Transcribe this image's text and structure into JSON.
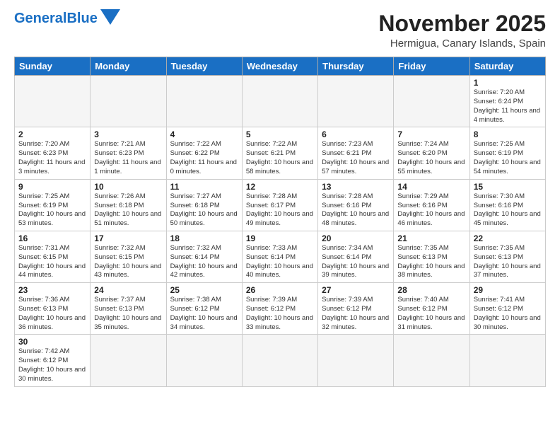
{
  "header": {
    "logo_general": "General",
    "logo_blue": "Blue",
    "month_title": "November 2025",
    "location": "Hermigua, Canary Islands, Spain"
  },
  "weekdays": [
    "Sunday",
    "Monday",
    "Tuesday",
    "Wednesday",
    "Thursday",
    "Friday",
    "Saturday"
  ],
  "weeks": [
    [
      {
        "day": "",
        "info": ""
      },
      {
        "day": "",
        "info": ""
      },
      {
        "day": "",
        "info": ""
      },
      {
        "day": "",
        "info": ""
      },
      {
        "day": "",
        "info": ""
      },
      {
        "day": "",
        "info": ""
      },
      {
        "day": "1",
        "info": "Sunrise: 7:20 AM\nSunset: 6:24 PM\nDaylight: 11 hours\nand 4 minutes."
      }
    ],
    [
      {
        "day": "2",
        "info": "Sunrise: 7:20 AM\nSunset: 6:23 PM\nDaylight: 11 hours\nand 3 minutes."
      },
      {
        "day": "3",
        "info": "Sunrise: 7:21 AM\nSunset: 6:23 PM\nDaylight: 11 hours\nand 1 minute."
      },
      {
        "day": "4",
        "info": "Sunrise: 7:22 AM\nSunset: 6:22 PM\nDaylight: 11 hours\nand 0 minutes."
      },
      {
        "day": "5",
        "info": "Sunrise: 7:22 AM\nSunset: 6:21 PM\nDaylight: 10 hours\nand 58 minutes."
      },
      {
        "day": "6",
        "info": "Sunrise: 7:23 AM\nSunset: 6:21 PM\nDaylight: 10 hours\nand 57 minutes."
      },
      {
        "day": "7",
        "info": "Sunrise: 7:24 AM\nSunset: 6:20 PM\nDaylight: 10 hours\nand 55 minutes."
      },
      {
        "day": "8",
        "info": "Sunrise: 7:25 AM\nSunset: 6:19 PM\nDaylight: 10 hours\nand 54 minutes."
      }
    ],
    [
      {
        "day": "9",
        "info": "Sunrise: 7:25 AM\nSunset: 6:19 PM\nDaylight: 10 hours\nand 53 minutes."
      },
      {
        "day": "10",
        "info": "Sunrise: 7:26 AM\nSunset: 6:18 PM\nDaylight: 10 hours\nand 51 minutes."
      },
      {
        "day": "11",
        "info": "Sunrise: 7:27 AM\nSunset: 6:18 PM\nDaylight: 10 hours\nand 50 minutes."
      },
      {
        "day": "12",
        "info": "Sunrise: 7:28 AM\nSunset: 6:17 PM\nDaylight: 10 hours\nand 49 minutes."
      },
      {
        "day": "13",
        "info": "Sunrise: 7:28 AM\nSunset: 6:16 PM\nDaylight: 10 hours\nand 48 minutes."
      },
      {
        "day": "14",
        "info": "Sunrise: 7:29 AM\nSunset: 6:16 PM\nDaylight: 10 hours\nand 46 minutes."
      },
      {
        "day": "15",
        "info": "Sunrise: 7:30 AM\nSunset: 6:16 PM\nDaylight: 10 hours\nand 45 minutes."
      }
    ],
    [
      {
        "day": "16",
        "info": "Sunrise: 7:31 AM\nSunset: 6:15 PM\nDaylight: 10 hours\nand 44 minutes."
      },
      {
        "day": "17",
        "info": "Sunrise: 7:32 AM\nSunset: 6:15 PM\nDaylight: 10 hours\nand 43 minutes."
      },
      {
        "day": "18",
        "info": "Sunrise: 7:32 AM\nSunset: 6:14 PM\nDaylight: 10 hours\nand 42 minutes."
      },
      {
        "day": "19",
        "info": "Sunrise: 7:33 AM\nSunset: 6:14 PM\nDaylight: 10 hours\nand 40 minutes."
      },
      {
        "day": "20",
        "info": "Sunrise: 7:34 AM\nSunset: 6:14 PM\nDaylight: 10 hours\nand 39 minutes."
      },
      {
        "day": "21",
        "info": "Sunrise: 7:35 AM\nSunset: 6:13 PM\nDaylight: 10 hours\nand 38 minutes."
      },
      {
        "day": "22",
        "info": "Sunrise: 7:35 AM\nSunset: 6:13 PM\nDaylight: 10 hours\nand 37 minutes."
      }
    ],
    [
      {
        "day": "23",
        "info": "Sunrise: 7:36 AM\nSunset: 6:13 PM\nDaylight: 10 hours\nand 36 minutes."
      },
      {
        "day": "24",
        "info": "Sunrise: 7:37 AM\nSunset: 6:13 PM\nDaylight: 10 hours\nand 35 minutes."
      },
      {
        "day": "25",
        "info": "Sunrise: 7:38 AM\nSunset: 6:12 PM\nDaylight: 10 hours\nand 34 minutes."
      },
      {
        "day": "26",
        "info": "Sunrise: 7:39 AM\nSunset: 6:12 PM\nDaylight: 10 hours\nand 33 minutes."
      },
      {
        "day": "27",
        "info": "Sunrise: 7:39 AM\nSunset: 6:12 PM\nDaylight: 10 hours\nand 32 minutes."
      },
      {
        "day": "28",
        "info": "Sunrise: 7:40 AM\nSunset: 6:12 PM\nDaylight: 10 hours\nand 31 minutes."
      },
      {
        "day": "29",
        "info": "Sunrise: 7:41 AM\nSunset: 6:12 PM\nDaylight: 10 hours\nand 30 minutes."
      }
    ],
    [
      {
        "day": "30",
        "info": "Sunrise: 7:42 AM\nSunset: 6:12 PM\nDaylight: 10 hours\nand 30 minutes."
      },
      {
        "day": "",
        "info": ""
      },
      {
        "day": "",
        "info": ""
      },
      {
        "day": "",
        "info": ""
      },
      {
        "day": "",
        "info": ""
      },
      {
        "day": "",
        "info": ""
      },
      {
        "day": "",
        "info": ""
      }
    ]
  ]
}
